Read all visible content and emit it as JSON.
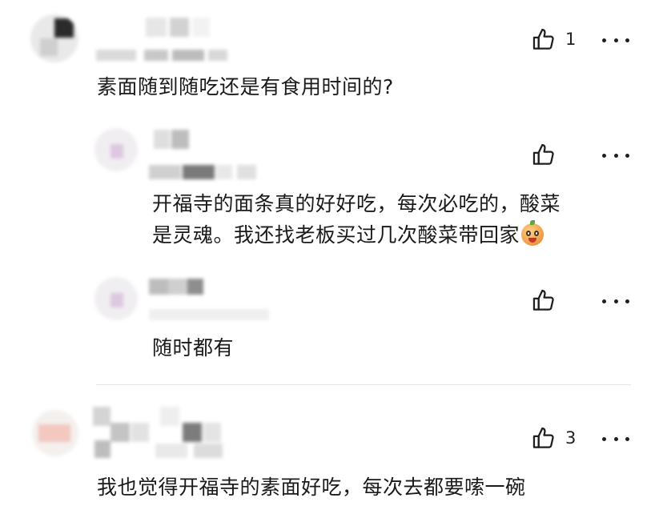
{
  "comments": [
    {
      "text": "素面随到随吃还是有食用时间的?",
      "like_count": "1",
      "replies": [
        {
          "text_lines": [
            "开福寺的面条真的好好吃，每次必吃的，酸菜",
            "是灵魂。我还找老板买过几次酸菜带回家"
          ],
          "emoji_icon": "grinning-face-emoji-icon"
        },
        {
          "text": "随时都有"
        }
      ]
    },
    {
      "text": "我也觉得开福寺的素面好吃，每次去都要嗦一碗",
      "like_count": "3"
    }
  ],
  "icons": {
    "like": "thumbs-up-icon",
    "more": "more-dots-icon"
  }
}
